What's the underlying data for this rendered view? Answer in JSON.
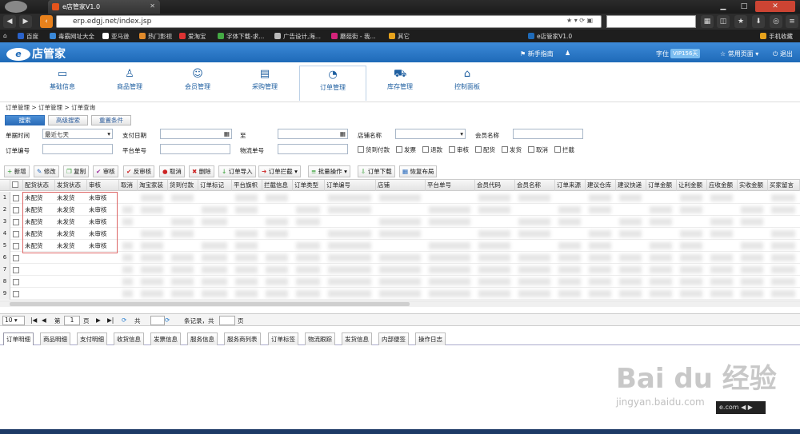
{
  "browser": {
    "tab_title": "e店管家V1.0",
    "url": "erp.edgj.net/index.jsp"
  },
  "bookmarks": [
    "百度",
    "毒霸网址大全",
    "亚马逊",
    "热门影视",
    "爱淘宝",
    "字体下载-求...",
    "广告设计,海...",
    "蘑菇街 - 我...",
    "其它",
    "e店管家V1.0",
    "手机收藏"
  ],
  "bookmark_colors": [
    "#2a62c9",
    "#3a88d8",
    "#222",
    "#e08a2b",
    "#d33",
    "#777",
    "#666",
    "#d4237a",
    "#e6a21c",
    "#1e6ab8",
    "#e6a21c"
  ],
  "header": {
    "logo": "店管家",
    "logo_badge": "e",
    "guide": "新手指南",
    "vip": "VIP156天",
    "user_suffix": "字住",
    "common_pages": "常用页面",
    "logout": "退出"
  },
  "modules": [
    {
      "label": "基础信息",
      "icon": "▭"
    },
    {
      "label": "商品管理",
      "icon": "♙"
    },
    {
      "label": "会员管理",
      "icon": "☺"
    },
    {
      "label": "采购管理",
      "icon": "▤"
    },
    {
      "label": "订单管理",
      "icon": "◔"
    },
    {
      "label": "库存管理",
      "icon": "⛟"
    },
    {
      "label": "控制面板",
      "icon": "⌂"
    }
  ],
  "breadcrumb": "订单管理 > 订单管理 > 订单查询",
  "search_buttons": {
    "search": "搜索",
    "advanced": "高级搜索",
    "reset": "重置条件"
  },
  "filters": {
    "order_time_label": "单据时间",
    "order_time_value": "最近七天",
    "pay_date_label": "支付日期",
    "to_label": "至",
    "shop_label": "店铺名称",
    "member_label": "会员名称",
    "order_no_label": "订单编号",
    "platform_no_label": "平台单号",
    "logistics_no_label": "物流单号"
  },
  "checks": [
    "货到付款",
    "发票",
    "退款",
    "审核",
    "配货",
    "发货",
    "取消",
    "拦截"
  ],
  "actions": [
    {
      "icon": "+",
      "label": "新增",
      "c": "g"
    },
    {
      "icon": "✎",
      "label": "修改",
      "c": "b"
    },
    {
      "icon": "❐",
      "label": "复制",
      "c": "g"
    },
    {
      "icon": "✔",
      "label": "审核",
      "c": "p"
    },
    {
      "icon": "✔",
      "label": "反审核",
      "c": "r"
    },
    {
      "icon": "●",
      "label": "取消",
      "c": "r"
    },
    {
      "icon": "✖",
      "label": "删除",
      "c": "r"
    },
    {
      "icon": "↓",
      "label": "订单导入",
      "c": "g"
    },
    {
      "icon": "➜",
      "label": "订单拦截 ▾",
      "c": "r"
    },
    {
      "icon": "≡",
      "label": "批量操作 ▾",
      "c": "g"
    },
    {
      "icon": "⇩",
      "label": "订单下载",
      "c": "g"
    },
    {
      "icon": "▦",
      "label": "恢复布局",
      "c": "b"
    }
  ],
  "columns": [
    "配货状态",
    "发货状态",
    "审核",
    "取消",
    "淘宝家装",
    "货到付款",
    "订单标记",
    "平台旗帜",
    "拦截信息",
    "订单类型",
    "订单编号",
    "店铺",
    "平台单号",
    "会员代码",
    "会员名称",
    "订单来源",
    "建议仓库",
    "建议快递",
    "订单金额",
    "让利金额",
    "应收金额",
    "实收金额",
    "买家留言"
  ],
  "rows": [
    {
      "n": "1",
      "a": "未配货",
      "b": "未发货",
      "c": "未审核"
    },
    {
      "n": "2",
      "a": "未配货",
      "b": "未发货",
      "c": "未审核"
    },
    {
      "n": "3",
      "a": "未配货",
      "b": "未发货",
      "c": "未审核"
    },
    {
      "n": "4",
      "a": "未配货",
      "b": "未发货",
      "c": "未审核"
    },
    {
      "n": "5",
      "a": "未配货",
      "b": "未发货",
      "c": "未审核"
    },
    {
      "n": "6",
      "a": "",
      "b": "",
      "c": ""
    },
    {
      "n": "7",
      "a": "",
      "b": "",
      "c": ""
    },
    {
      "n": "8",
      "a": "",
      "b": "",
      "c": ""
    },
    {
      "n": "9",
      "a": "",
      "b": "",
      "c": ""
    }
  ],
  "pager": {
    "page_size": "10",
    "page_label": "第",
    "page": "1",
    "total_label": "页",
    "of_label": "共",
    "records_label": "条记录，共",
    "pages_label": "页"
  },
  "bottom_tabs": [
    "订单明细",
    "商品明细",
    "支付明细",
    "收货信息",
    "发票信息",
    "服务信息",
    "服务商列表",
    "订单标签",
    "物流跟踪",
    "发货信息",
    "内部便签",
    "操作日志"
  ],
  "watermark": {
    "main": "Bai du 经验",
    "sub": "jingyan.baidu.com",
    "badge": "e.com"
  }
}
